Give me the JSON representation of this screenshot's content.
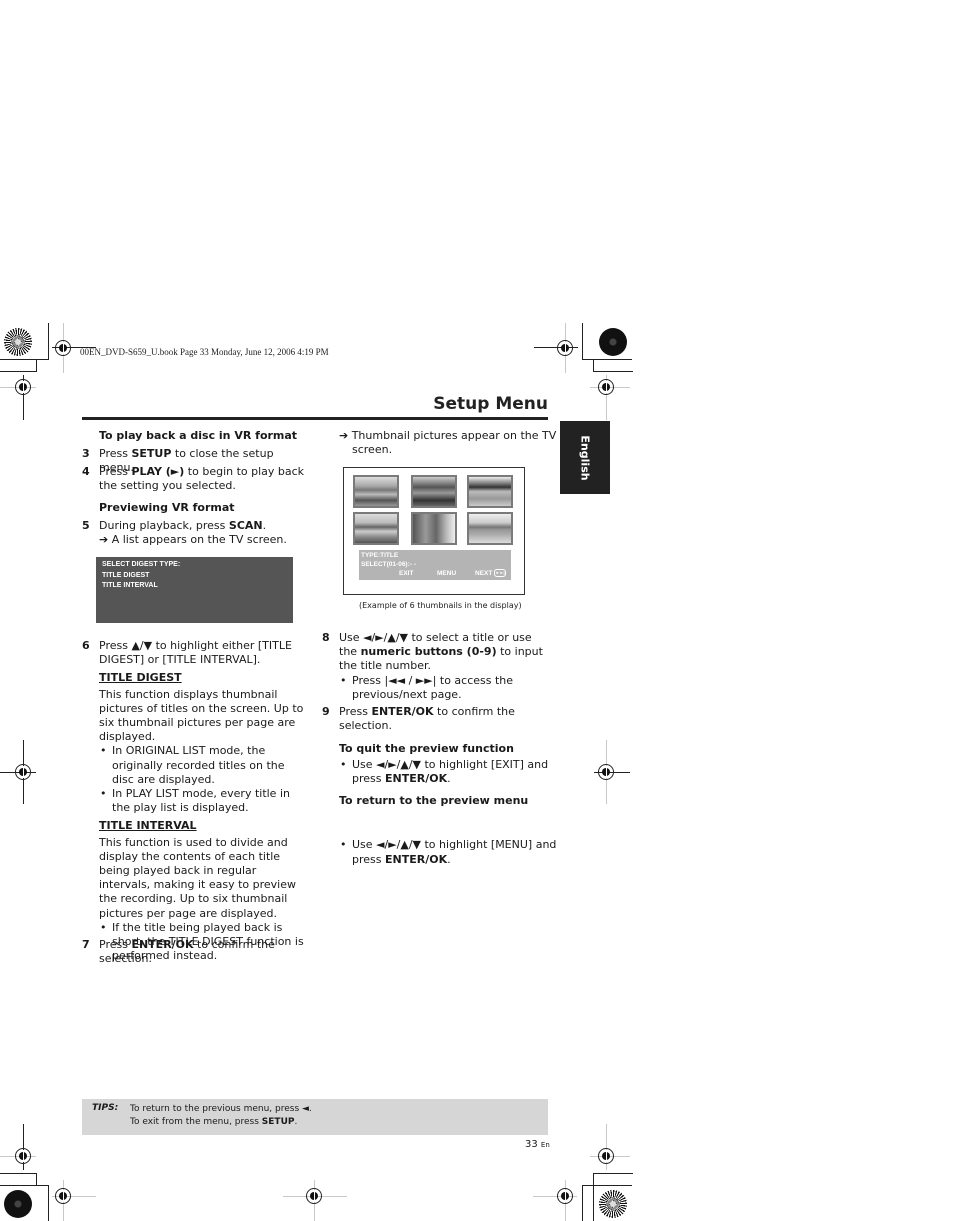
{
  "print_header": "00EN_DVD-S659_U.book  Page 33  Monday, June 12, 2006  4:19 PM",
  "page_title": "Setup Menu",
  "language_tab": "English",
  "left_column": {
    "heading_vr_playback": "To play back a disc in VR format",
    "step3": {
      "num": "3",
      "pre": "Press ",
      "key": "SETUP",
      "post": " to close the setup menu."
    },
    "step4": {
      "num": "4",
      "pre": "Press ",
      "key": "PLAY (►)",
      "post": " to begin to play back the setting you selected."
    },
    "heading_preview": "Previewing VR format",
    "step5": {
      "num": "5",
      "pre": "During playback, press ",
      "key": "SCAN",
      "post": ".",
      "result": "➔ A list appears on the TV screen."
    },
    "osd_menu": [
      "SELECT DIGEST TYPE:",
      "TITLE DIGEST",
      "TITLE INTERVAL"
    ],
    "step6": {
      "num": "6",
      "text": "Press ▲/▼ to highlight either [TITLE DIGEST] or [TITLE INTERVAL]."
    },
    "title_digest": {
      "heading": "TITLE DIGEST",
      "body": "This function displays thumbnail pictures of titles on the screen. Up to six thumbnail pictures per page are displayed.",
      "bullets": [
        "In ORIGINAL LIST mode, the originally recorded titles on the disc are displayed.",
        "In PLAY LIST mode, every title in the play list is displayed."
      ]
    },
    "title_interval": {
      "heading": "TITLE INTERVAL",
      "body": "This function is used to divide and display the contents of each title being played back in regular intervals, making it easy to preview the recording. Up to six thumbnail pictures per page are displayed.",
      "bullets": [
        "If the title being played back is short, the TITLE DIGEST function is performed instead."
      ]
    },
    "step7": {
      "num": "7",
      "pre": "Press ",
      "key": "ENTER/OK",
      "post": " to confirm the selection."
    }
  },
  "right_column": {
    "result_thumbnails": "➔ Thumbnail pictures appear on the TV screen.",
    "tv_display": {
      "thumbnails": [
        "thumbnail-1",
        "thumbnail-2",
        "thumbnail-3",
        "thumbnail-4",
        "thumbnail-5",
        "thumbnail-6"
      ],
      "type_line": "TYPE:TITLE",
      "select_line": "SELECT(01-06):- -",
      "exit": "EXIT",
      "menu": "MENU",
      "next": "NEXT",
      "next_icon": "►►|"
    },
    "caption": "(Example of 6 thumbnails in the display)",
    "step8": {
      "num": "8",
      "pre": "Use ◄/►/▲/▼ to select a title or use the ",
      "key": "numeric buttons (0-9)",
      "post": " to input the title number.",
      "bullet": "Press |◄◄ / ►►| to access the previous/next page."
    },
    "step9": {
      "num": "9",
      "pre": "Press ",
      "key": "ENTER/OK",
      "post": " to confirm the selection."
    },
    "quit_heading": "To quit the preview function",
    "quit_bullet": {
      "pre": "Use ◄/►/▲/▼ to highlight [EXIT] and press ",
      "key": "ENTER/OK",
      "post": "."
    },
    "return_heading": "To return to the preview menu",
    "return_bullet": {
      "pre": "Use ◄/►/▲/▼ to highlight [MENU] and press ",
      "key": "ENTER/OK",
      "post": "."
    }
  },
  "tips": {
    "label": "TIPS:",
    "line1": "To return to the previous menu, press ◄.",
    "line2_pre": "To exit from the menu, press ",
    "line2_key": "SETUP",
    "line2_post": "."
  },
  "page_number": "33",
  "page_lang": "En"
}
